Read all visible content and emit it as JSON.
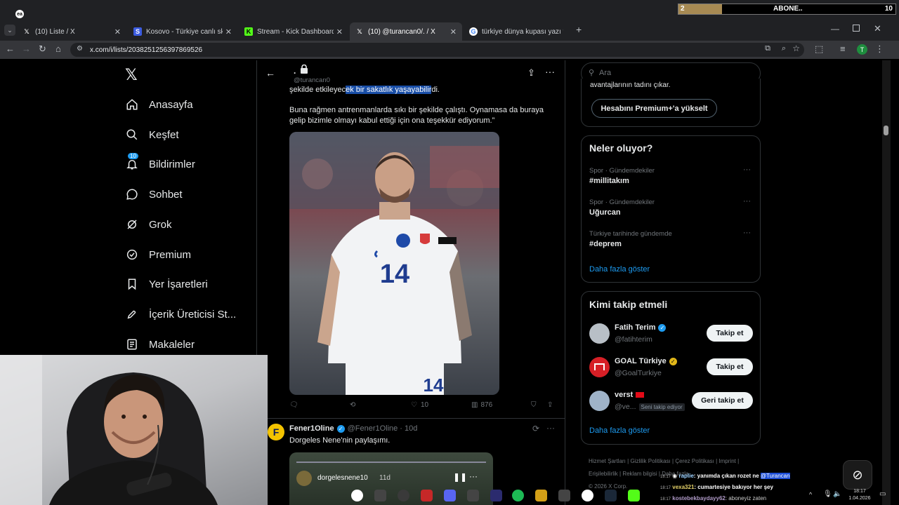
{
  "browser": {
    "tabs": [
      {
        "title": "(10) Liste / X",
        "favicon": "x-icon"
      },
      {
        "title": "Kosovo - Türkiye canlı skor, baş",
        "favicon": "sofascore-icon"
      },
      {
        "title": "Stream - Kick Dashboard",
        "favicon": "kick-icon"
      },
      {
        "title": "(10) @turancan0/. / X",
        "favicon": "x-icon"
      },
      {
        "title": "türkiye dünya kupası yazı tura -",
        "favicon": "google-icon"
      }
    ],
    "url": "x.com/i/lists/2038251256397869526",
    "profile_initial": "T"
  },
  "overlay": {
    "abone_label": "ABONE..",
    "abone_current": "2",
    "abone_goal": "10",
    "abone_progress": 0.2
  },
  "nav": {
    "items": [
      {
        "label": "Anasayfa",
        "icon": "home-icon"
      },
      {
        "label": "Keşfet",
        "icon": "search-icon"
      },
      {
        "label": "Bildirimler",
        "icon": "bell-icon",
        "badge": "10"
      },
      {
        "label": "Sohbet",
        "icon": "chat-icon"
      },
      {
        "label": "Grok",
        "icon": "grok-icon"
      },
      {
        "label": "Premium",
        "icon": "verified-icon"
      },
      {
        "label": "Yer İşaretleri",
        "icon": "bookmark-icon"
      },
      {
        "label": "İçerik Üreticisi St...",
        "icon": "rocket-icon"
      },
      {
        "label": "Makaleler",
        "icon": "article-icon"
      }
    ]
  },
  "header": {
    "name": ".",
    "handle": "@turancan0"
  },
  "tweet": {
    "line1_plain": "şekilde etkileyec",
    "line1_highlight": "ek bir sakatlık yaşayabilir",
    "line1_tail": "di.",
    "paragraph2": "Buna rağmen antrenmanlarda sıkı bir şekilde çalıştı. Oynamasa da buraya gelip bizimle olmayı kabul ettiği için ona teşekkür ediyorum.”",
    "jersey_number": "14",
    "likes": "10",
    "views": "876"
  },
  "tweet2": {
    "name": "Fener1Oline",
    "handle": "@Fener1Oline",
    "time": "· 10d",
    "text": "Dorgeles Nene'nin paylaşımı.",
    "story_user": "dorgelesnene10",
    "story_time": "11d"
  },
  "search": {
    "placeholder": "Ara"
  },
  "premium": {
    "cut_text": "avantajlarının tadını çıkar.",
    "button": "Hesabını Premium+'a yükselt"
  },
  "trends": {
    "title": "Neler oluyor?",
    "items": [
      {
        "meta": "Spor · Gündemdekiler",
        "tag": "#millitakım"
      },
      {
        "meta": "Spor · Gündemdekiler",
        "tag": "Uğurcan"
      },
      {
        "meta": "Türkiye tarihinde gündemde",
        "tag": "#deprem"
      }
    ],
    "more": "Daha fazla göster"
  },
  "whotofollow": {
    "title": "Kimi takip etmeli",
    "items": [
      {
        "name": "Fatih Terim",
        "handle": "@fatihterim",
        "button": "Takip et"
      },
      {
        "name": "GOAL Türkiye",
        "handle": "@GoalTurkiye",
        "button": "Takip et"
      },
      {
        "name": "verst",
        "handle": "@ve...",
        "follows_you": "Seni takip ediyor",
        "button": "Geri takip et"
      }
    ],
    "more": "Daha fazla göster"
  },
  "footer": {
    "links": [
      "Hizmet Şartları",
      "Gizlilik Politikası",
      "Çerez Politikası",
      "Imprint",
      "Erişilebilirlik",
      "Reklam bilgisi",
      "Daha fazla ..."
    ],
    "copyright": "© 2026 X Corp."
  },
  "chat": [
    {
      "time": "18:17",
      "user": "raplie",
      "text": ": yanımda çıkan rozet ne ",
      "mention": "@Turancan"
    },
    {
      "time": "18:17",
      "user": "vexa321",
      "text": ": cumartesiye bakıyor her şey"
    },
    {
      "time": "18:17",
      "user": "kostebekbaydayy62",
      "text": ": aboneyiz zaten"
    }
  ],
  "systray": {
    "time": "18:17",
    "date": "1.04.2026"
  },
  "colors": {
    "accent_blue": "#1d9bf0",
    "gold": "#e2b719",
    "kick_green": "#53fc18"
  }
}
